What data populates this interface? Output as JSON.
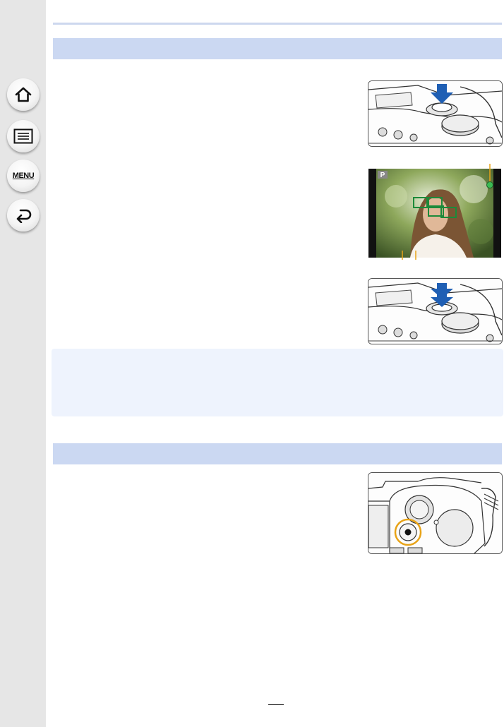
{
  "sidebar": {
    "buttons": [
      {
        "icon": "home-icon"
      },
      {
        "icon": "contents-list-icon"
      },
      {
        "icon": "menu-icon",
        "label": "MENU"
      },
      {
        "icon": "back-icon"
      }
    ]
  },
  "illustrations": {
    "shutter_half_press": {
      "icon": "shutter-press-icon"
    },
    "focus_screen": {
      "mode_label": "P"
    },
    "shutter_full_press": {
      "icon": "shutter-press-icon"
    },
    "motion_picture_button": {
      "icon": "record-button-icon"
    }
  },
  "colors": {
    "section_bar": "#cbd8f2",
    "note_box": "#eef3fd",
    "press_arrow": "#1f5fb4",
    "callout": "#e8a317",
    "focus_indicator": "#3cba54",
    "af_area": "#1c8a3a"
  }
}
